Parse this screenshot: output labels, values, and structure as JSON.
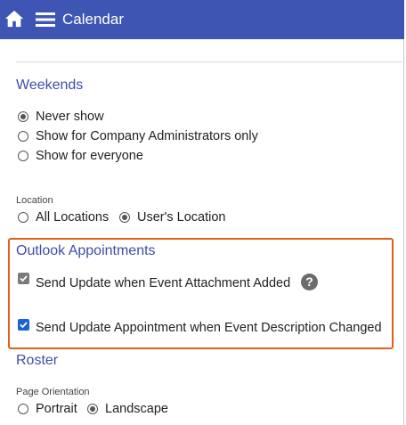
{
  "header": {
    "title": "Calendar",
    "home_icon": "home-icon",
    "menu_icon": "hamburger-menu-icon",
    "background_color": "#3f55b4"
  },
  "weekends": {
    "title": "Weekends",
    "options": [
      "Never show",
      "Show for Company Administrators only",
      "Show for everyone"
    ],
    "selected": "Never show"
  },
  "location": {
    "label": "Location",
    "options": [
      "All Locations",
      "User's Location"
    ],
    "selected": "User's Location"
  },
  "outlook": {
    "title": "Outlook Appointments",
    "attachment_label": "Send Update when Event Attachment Added",
    "attachment_checked": true,
    "help_icon": "help-icon",
    "help_text": "?",
    "description_label": "Send Update Appointment when Event Description Changed",
    "description_checked": true,
    "highlight_color": "#e0611c"
  },
  "roster": {
    "title": "Roster",
    "orientation_label": "Page Orientation",
    "options": [
      "Portrait",
      "Landscape"
    ],
    "selected": "Landscape"
  }
}
